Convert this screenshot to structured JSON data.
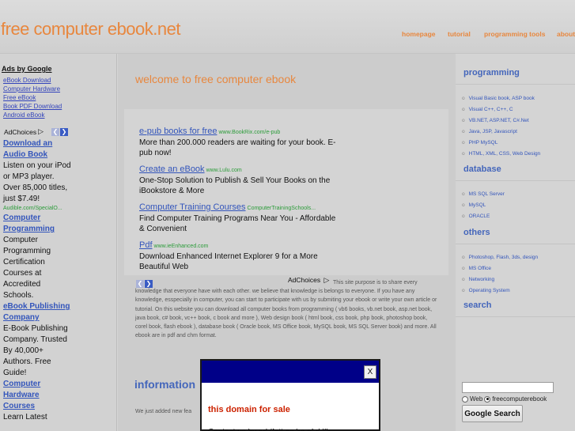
{
  "header": {
    "site_title": "free computer ebook.net",
    "nav": [
      "homepage",
      "tutorial",
      "programming tools",
      "about"
    ]
  },
  "left": {
    "ads_by_google": "Ads by Google",
    "links": [
      "eBook Download",
      "Computer Hardware",
      "Free eBook",
      "Book PDF Download",
      "Android eBook"
    ],
    "adchoices": "AdChoices",
    "ads": [
      {
        "title": "Download an Audio Book",
        "desc": "Listen on your iPod or MP3 player. Over 85,000 titles, just $7.49!",
        "url": "Audible.com/SpecialO..."
      },
      {
        "title": "Computer Programming",
        "desc": "Computer Programming Certification Courses at Accredited Schools."
      },
      {
        "title": "eBook Publishing Company",
        "desc": "E-Book Publishing Company. Trusted By 40,000+ Authors. Free Guide!"
      },
      {
        "title": "Computer Hardware Courses",
        "desc": "Learn Latest"
      }
    ]
  },
  "main": {
    "welcome": "welcome to free computer ebook",
    "ads": [
      {
        "title": "e-pub books for free",
        "url": "www.BookRix.com/e-pub",
        "desc": "More than 200.000 readers are waiting for your book. E-pub now!"
      },
      {
        "title": "Create an eBook",
        "url": "www.Lulu.com",
        "desc": "One-Stop Solution to Publish & Sell Your Books on the iBookstore & More"
      },
      {
        "title": "Computer Training Courses",
        "url": "ComputerTrainingSchools...",
        "desc": "Find Computer Training Programs Near You - Affordable & Convenient"
      },
      {
        "title": "Pdf",
        "url": "www.ieEnhanced.com",
        "desc": "Download Enhanced Internet Explorer 9 for a More Beautiful Web"
      }
    ],
    "adchoices": "AdChoices",
    "purpose_text": "This site purpose is to share every knowledge that everyone have with each other. we believe that knowledge is belongs to everyone. If you have any knowledge, esspecially in computer, you can start to participate with us by submiting your ebook or write your own article or tutorial. On this website you can download all computer books from programming ( vb6 books, vb.net book, asp.net book, java book, c# book, vc++ book, c book and more ), Web design book ( html book, css book, php book, photoshop book, corel book, flash ebook ), database book ( Oracle book, MS Office book, MySQL book, MS SQL Server book) and more. All ebook are in pdf and chm format.",
    "info_heading": "information",
    "just_added": "We just added new fea"
  },
  "right": {
    "sections": [
      {
        "heading": "programming",
        "items": [
          "Visual Basic book, ASP book",
          "Visual C++, C++, C",
          "VB.NET, ASP.NET, C#.Net",
          "Java, JSP, Javascript",
          "PHP MySQL",
          "HTML, XML, CSS, Web Design"
        ]
      },
      {
        "heading": "database",
        "items": [
          "MS SQL Server",
          "MySQL",
          "ORACLE"
        ]
      },
      {
        "heading": "others",
        "items": [
          "Photoshop, Flash, 3ds, design",
          "MS Office",
          "Networking",
          "Operating System"
        ]
      }
    ],
    "search_heading": "search",
    "search_input_value": "",
    "radio_web": "Web",
    "radio_site": "freecomputerebook",
    "search_button": "Google Search"
  },
  "modal": {
    "close": "X",
    "title": "this domain for sale",
    "line": "Contact us by ad (fatt as ho of d lfh"
  },
  "colors": {
    "accent_orange": "#e8873e",
    "link_blue": "#3355bb",
    "modal_bar": "#000088",
    "url_green": "#2c9c3a"
  }
}
